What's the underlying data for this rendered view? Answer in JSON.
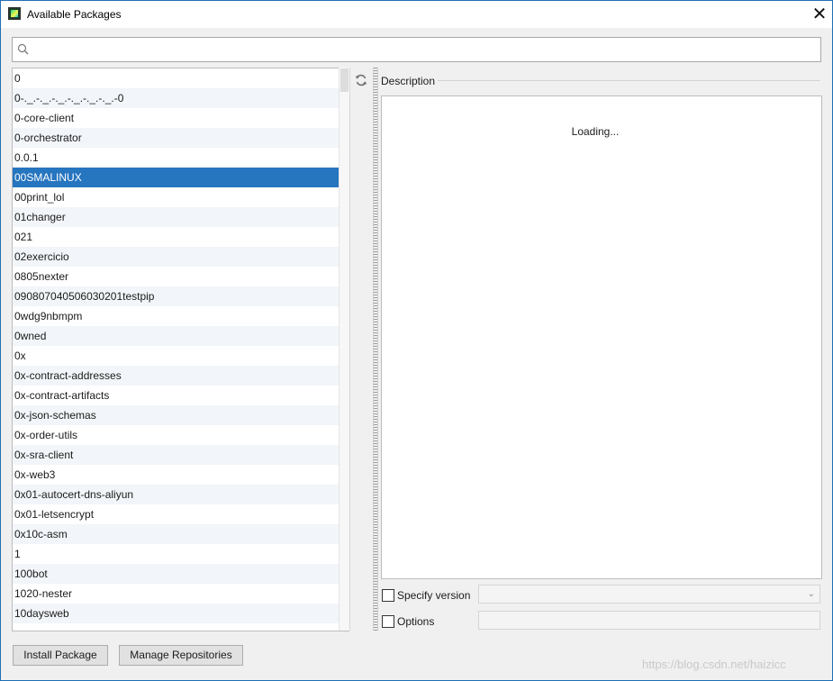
{
  "window": {
    "title": "Available Packages",
    "close_label": "✕"
  },
  "search": {
    "value": "",
    "placeholder": ""
  },
  "packages": [
    "0",
    "0-._.-._.-._.-._.-._.-._.-0",
    "0-core-client",
    "0-orchestrator",
    "0.0.1",
    "00SMALINUX",
    "00print_lol",
    "01changer",
    "021",
    "02exercicio",
    "0805nexter",
    "090807040506030201testpip",
    "0wdg9nbmpm",
    "0wned",
    "0x",
    "0x-contract-addresses",
    "0x-contract-artifacts",
    "0x-json-schemas",
    "0x-order-utils",
    "0x-sra-client",
    "0x-web3",
    "0x01-autocert-dns-aliyun",
    "0x01-letsencrypt",
    "0x10c-asm",
    "1",
    "100bot",
    "1020-nester",
    "10daysweb"
  ],
  "selected_package": "00SMALINUX",
  "description": {
    "label": "Description",
    "content": "Loading..."
  },
  "specify_version": {
    "label": "Specify version",
    "checked": false,
    "value": ""
  },
  "options": {
    "label": "Options",
    "checked": false,
    "value": ""
  },
  "buttons": {
    "install": "Install Package",
    "manage": "Manage Repositories"
  },
  "watermark": "https://blog.csdn.net/haizicc",
  "colors": {
    "selection": "#2675bf",
    "window_border": "#1f6fb5"
  }
}
